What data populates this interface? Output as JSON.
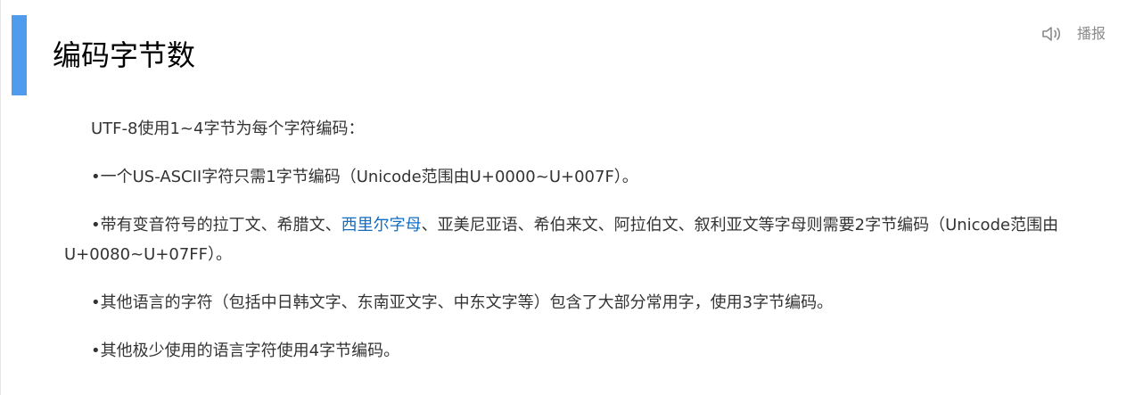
{
  "heading": {
    "title": "编码字节数"
  },
  "toolbar": {
    "speak_label": "播报",
    "speak_icon": "speaker-icon"
  },
  "colors": {
    "accent_bar": "#4f9cee",
    "link": "#136ec2"
  },
  "paragraphs": {
    "p1": "UTF-8使用1~4字节为每个字符编码：",
    "p2": "•一个US-ASCII字符只需1字节编码（Unicode范围由U+0000~U+007F）。",
    "p3_before": "•带有变音符号的拉丁文、希腊文、",
    "p3_link": "西里尔字母",
    "p3_after": "、亚美尼亚语、希伯来文、阿拉伯文、叙利亚文等字母则需要2字节编码（Unicode范围由U+0080~U+07FF）。",
    "p4": "•其他语言的字符（包括中日韩文字、东南亚文字、中东文字等）包含了大部分常用字，使用3字节编码。",
    "p5": "•其他极少使用的语言字符使用4字节编码。"
  }
}
